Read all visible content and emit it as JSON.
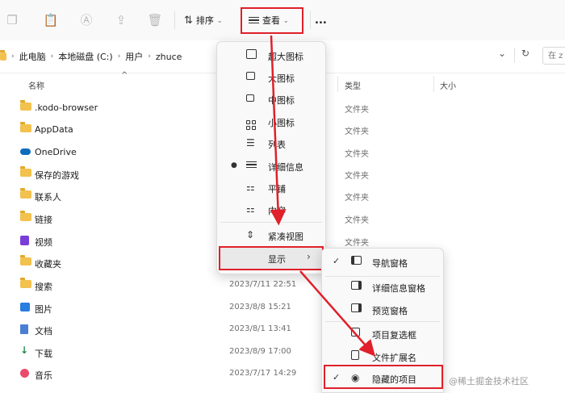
{
  "toolbar": {
    "sort_label": "排序",
    "view_label": "查看",
    "more_label": "...",
    "icons": [
      "copy-icon",
      "paste-icon",
      "rename-icon",
      "share-icon",
      "delete-icon"
    ]
  },
  "address": {
    "crumbs": [
      "此电脑",
      "本地磁盘 (C:)",
      "用户",
      "zhuce"
    ],
    "search_placeholder": "在 z"
  },
  "columns": {
    "name": "名称",
    "type": "类型",
    "size": "大小"
  },
  "files": [
    {
      "name": ".kodo-browser",
      "date": "",
      "type": "文件夹",
      "icon": "folder"
    },
    {
      "name": "AppData",
      "date": "",
      "type": "文件夹",
      "icon": "folder"
    },
    {
      "name": "OneDrive",
      "date": "",
      "type": "文件夹",
      "icon": "onedrive"
    },
    {
      "name": "保存的游戏",
      "date": "",
      "type": "文件夹",
      "icon": "folder"
    },
    {
      "name": "联系人",
      "date": "",
      "type": "文件夹",
      "icon": "folder"
    },
    {
      "name": "链接",
      "date": "",
      "type": "文件夹",
      "icon": "folder"
    },
    {
      "name": "视频",
      "date": "",
      "type": "文件夹",
      "icon": "video"
    },
    {
      "name": "收藏夹",
      "date": "",
      "type": "",
      "icon": "folder"
    },
    {
      "name": "搜索",
      "date": "2023/7/11 22:51",
      "type": "",
      "icon": "folder"
    },
    {
      "name": "图片",
      "date": "2023/8/8 15:21",
      "type": "",
      "icon": "picture"
    },
    {
      "name": "文档",
      "date": "2023/8/1 13:41",
      "type": "",
      "icon": "document"
    },
    {
      "name": "下载",
      "date": "2023/8/9 17:00",
      "type": "",
      "icon": "download"
    },
    {
      "name": "音乐",
      "date": "2023/7/17 14:29",
      "type": "",
      "icon": "music"
    }
  ],
  "view_menu": {
    "items": [
      {
        "label": "超大图标",
        "icon": "extra-large-icons"
      },
      {
        "label": "大图标",
        "icon": "large-icons"
      },
      {
        "label": "中图标",
        "icon": "medium-icons"
      },
      {
        "label": "小图标",
        "icon": "small-icons"
      },
      {
        "label": "列表",
        "icon": "list"
      },
      {
        "label": "详细信息",
        "icon": "details",
        "selected": true
      },
      {
        "label": "平铺",
        "icon": "tiles"
      },
      {
        "label": "内容",
        "icon": "content"
      },
      {
        "label": "紧凑视图",
        "icon": "compact-view"
      },
      {
        "label": "显示",
        "icon": "",
        "submenu": true
      }
    ]
  },
  "show_submenu": {
    "items": [
      {
        "label": "导航窗格",
        "icon": "navigation-pane",
        "checked": true
      },
      {
        "label": "详细信息窗格",
        "icon": "details-pane"
      },
      {
        "label": "预览窗格",
        "icon": "preview-pane"
      },
      {
        "label": "项目复选框",
        "icon": "item-checkbox"
      },
      {
        "label": "文件扩展名",
        "icon": "file-extension"
      },
      {
        "label": "隐藏的项目",
        "icon": "hidden-items",
        "checked": true
      }
    ]
  },
  "watermark": "@稀土掘金技术社区",
  "colors": {
    "highlight": "#e0202a",
    "folder": "#f2c14e"
  }
}
